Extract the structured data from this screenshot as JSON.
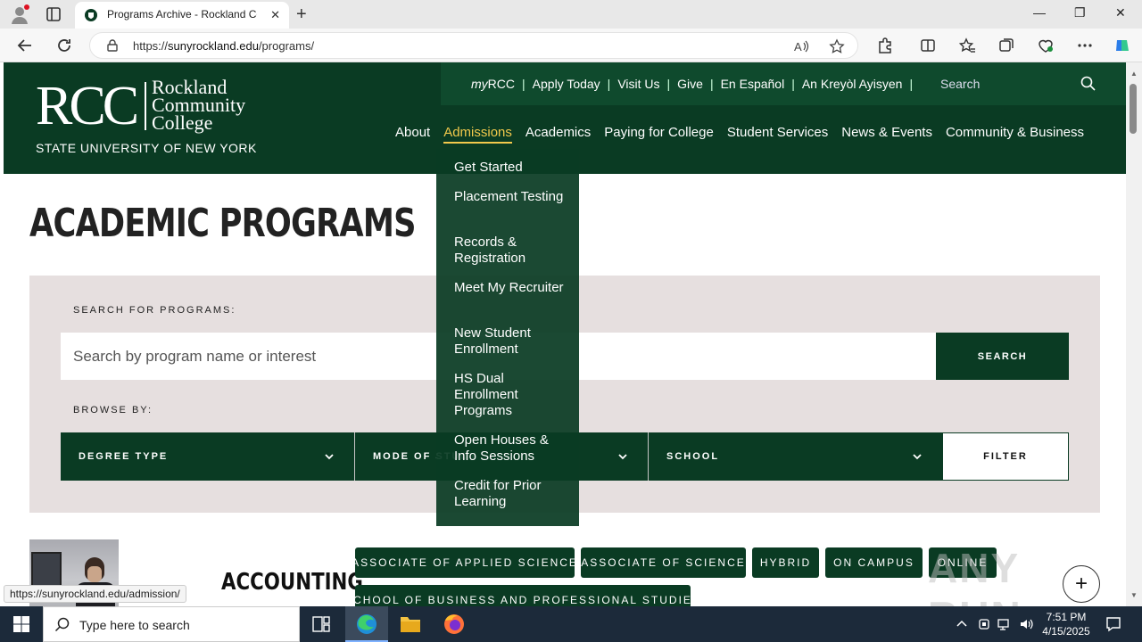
{
  "browser": {
    "tab_title": "Programs Archive - Rockland Co",
    "url_scheme": "https://",
    "url_host": "sunyrockland.edu",
    "url_path": "/programs/",
    "status_url": "https://sunyrockland.edu/admission/"
  },
  "header": {
    "logo_letters": "RCC",
    "logo_name_lines": [
      "Rockland",
      "Community",
      "College"
    ],
    "logo_suny": "STATE UNIVERSITY OF NEW YORK",
    "util_links": [
      {
        "prefix": "my",
        "label": "RCC"
      },
      {
        "prefix": "",
        "label": "Apply Today"
      },
      {
        "prefix": "",
        "label": "Visit Us"
      },
      {
        "prefix": "",
        "label": "Give"
      },
      {
        "prefix": "",
        "label": "En Español"
      },
      {
        "prefix": "",
        "label": "An Kreyòl Ayisyen"
      }
    ],
    "search_placeholder": "Search",
    "nav": [
      "About",
      "Admissions",
      "Academics",
      "Paying for College",
      "Student Services",
      "News & Events",
      "Community & Business"
    ]
  },
  "dropdown": {
    "items": [
      "Get Started",
      "Placement Testing",
      "Records & Registration",
      "Meet My Recruiter",
      "New Student Enrollment",
      "HS Dual Enrollment Programs",
      "Open Houses & Info Sessions",
      "Credit for Prior Learning"
    ]
  },
  "main": {
    "title": "ACADEMIC PROGRAMS",
    "search_label": "SEARCH FOR PROGRAMS:",
    "search_placeholder": "Search by program name or interest",
    "search_button": "SEARCH",
    "browse_label": "BROWSE BY:",
    "filters": [
      "DEGREE TYPE",
      "MODE OF STUDY",
      "SCHOOL"
    ],
    "filter_button": "FILTER"
  },
  "program": {
    "name": "ACCOUNTING",
    "tags": [
      "ASSOCIATE OF APPLIED SCIENCE",
      "ASSOCIATE OF SCIENCE",
      "HYBRID",
      "ON CAMPUS",
      "ONLINE",
      "SCHOOL OF BUSINESS AND PROFESSIONAL STUDIES"
    ]
  },
  "watermark": "ANY RUN",
  "taskbar": {
    "search_placeholder": "Type here to search",
    "time": "7:51 PM",
    "date": "4/15/2025"
  },
  "colors": {
    "brand_green": "#0a3b23",
    "accent_yellow": "#f2c94c",
    "panel_gray": "#e6dfdf"
  }
}
